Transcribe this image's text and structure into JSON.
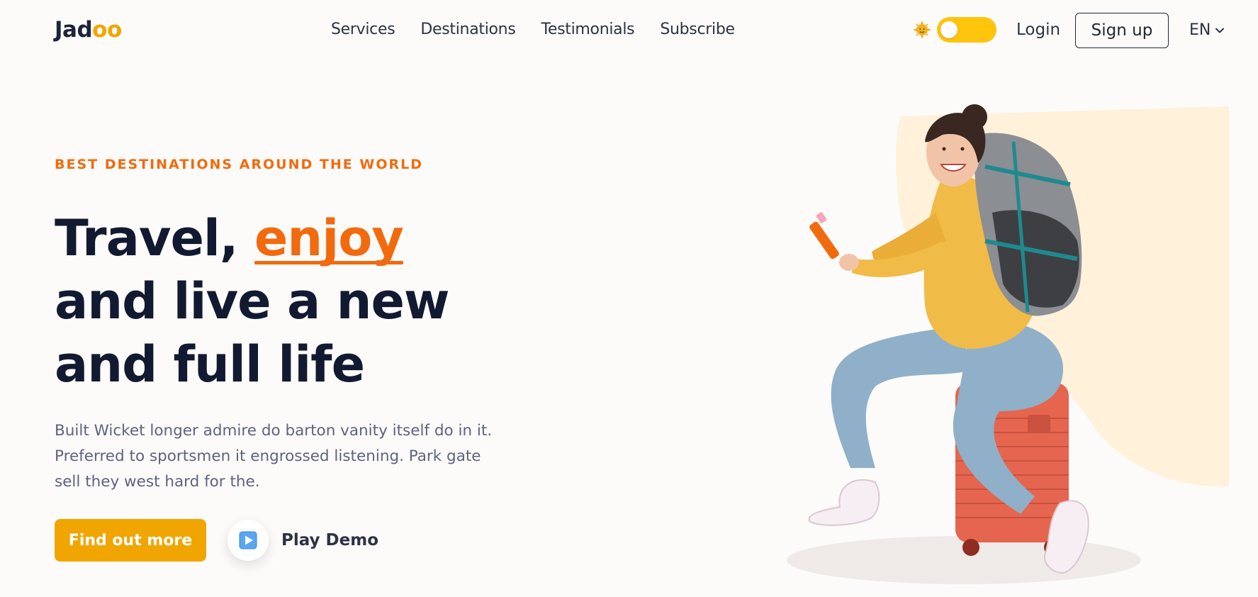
{
  "nav": {
    "logo_main": "Jad",
    "logo_accent": "oo",
    "links": [
      "Services",
      "Destinations",
      "Testimonials",
      "Subscribe"
    ],
    "login": "Login",
    "signup": "Sign up",
    "language": "EN"
  },
  "hero": {
    "eyebrow": "BEST DESTINATIONS AROUND THE WORLD",
    "headline_part1": "Travel, ",
    "headline_highlight": "enjoy",
    "headline_line2": "and live a new",
    "headline_line3": "and full life",
    "description": "Built Wicket longer admire do barton vanity itself do in it. Preferred to sportsmen it engrossed listening. Park gate sell they west hard for the.",
    "cta": "Find out more",
    "play_label": "Play Demo"
  },
  "colors": {
    "background": "#fdfbf9",
    "accent_orange": "#f26a0e",
    "accent_yellow": "#f1a501",
    "toggle": "#ffc40c",
    "heading": "#121a31",
    "body_text": "#5e6282",
    "hero_blob": "#fff1da"
  },
  "icons": {
    "theme": "sun-icon",
    "language": "chevron-down-icon",
    "play": "play-icon"
  }
}
